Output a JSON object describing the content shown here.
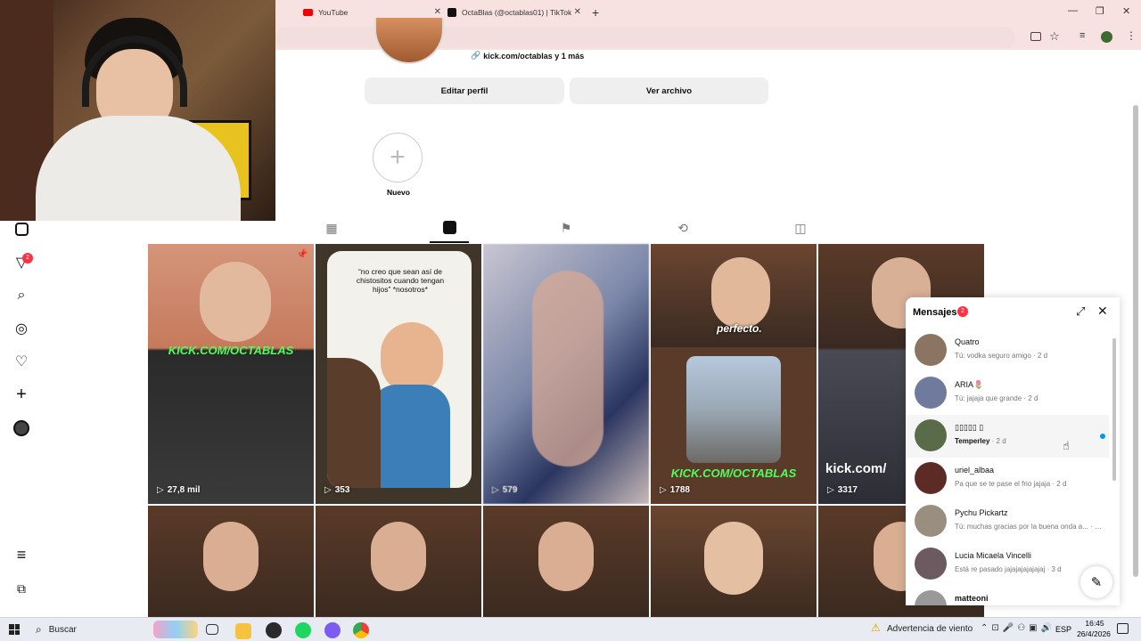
{
  "browser": {
    "tabs": [
      {
        "title": "YouTube",
        "icon": "youtube-icon"
      },
      {
        "title": "OctaBlas (@octablas01) | TikTok",
        "icon": "tiktok-icon"
      }
    ],
    "new_tab": "+",
    "controls": {
      "minimize": "—",
      "maximize": "❐",
      "close": "✕"
    }
  },
  "profile": {
    "link": "kick.com/octablas y 1 más",
    "edit_button": "Editar perfil",
    "archive_button": "Ver archivo",
    "highlight_new_label": "Nuevo"
  },
  "sidebar": {
    "notifications_badge": "2"
  },
  "grid": {
    "row1": [
      {
        "overlay_text": "KICK.COM/OCTABLAS",
        "views": "27,8 mil",
        "pinned": true
      },
      {
        "caption": "“no creo que sean así de chistositos cuando tengan hijos” *nosotros*",
        "views": "353"
      },
      {
        "views": "579"
      },
      {
        "caption": "perfecto.",
        "overlay_text": "KICK.COM/OCTABLAS",
        "views": "1788"
      },
      {
        "overlay_text": "kick.com/",
        "views": "3317"
      }
    ]
  },
  "messages": {
    "title": "Mensajes",
    "badge": "2",
    "items": [
      {
        "name": "Quatro",
        "sub": "Tú: vodka seguro amigo · 2 d"
      },
      {
        "name": "ARIA🌷",
        "sub": "Tú: jajaja que grande · 2 d"
      },
      {
        "name": "▯▯▯▯▯ ▯",
        "sub_bold": "Temperley",
        "sub": " · 2 d",
        "unread": true
      },
      {
        "name": "uriel_albaa",
        "sub": "Pa que se te pase el frio jajaja · 2 d"
      },
      {
        "name": "Pychu Pickartz",
        "sub": "Tú: muchas gracias por la buena onda a... · 2 d"
      },
      {
        "name": "Lucia Micaela Vincelli",
        "sub": "Está re pasado jajajajajajajaj · 3 d"
      },
      {
        "name": "matteoni",
        "sub": ""
      }
    ]
  },
  "taskbar": {
    "search_placeholder": "Buscar",
    "weather": "Advertencia de viento",
    "lang": "ESP",
    "time": "16:45",
    "date": "26/4/2026"
  },
  "colors": {
    "accent_red": "#ff3040",
    "unread_dot": "#0095f6",
    "tab_bg": "#f8e1e1"
  }
}
